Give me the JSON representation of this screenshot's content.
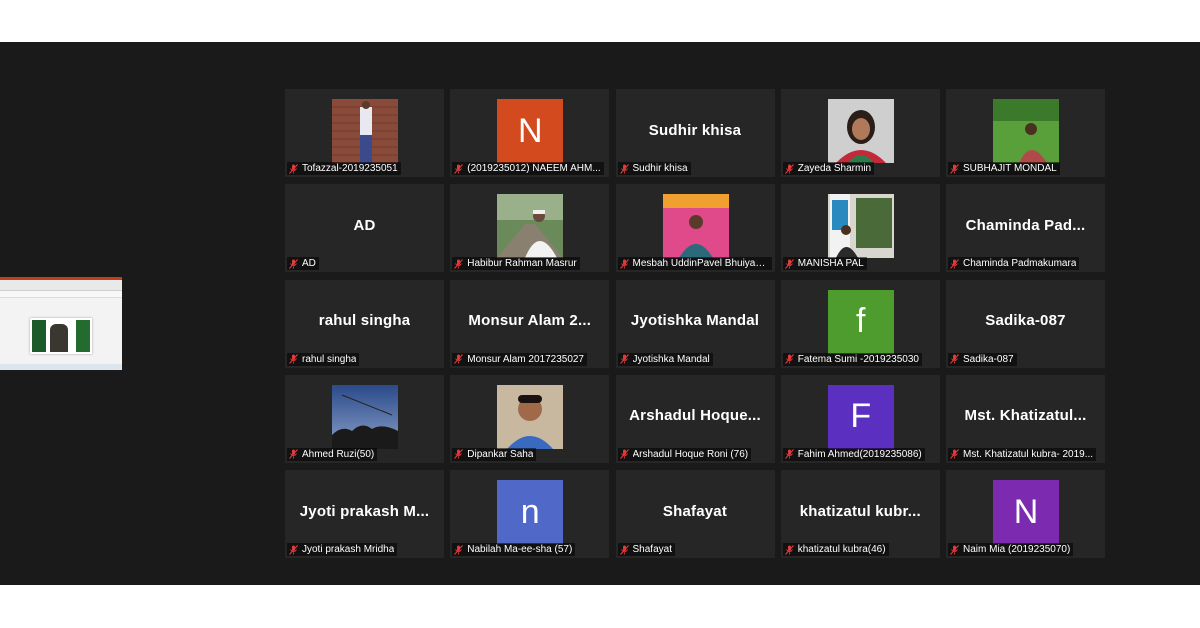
{
  "colors": {
    "background": "#1a1a1a",
    "tile": "#262626",
    "mic_muted": "#e03a3a"
  },
  "tiles": [
    {
      "label": "Tofazzal-2019235051",
      "type": "photo",
      "photo": "photo-brick-wall"
    },
    {
      "label": "(2019235012) NAEEM AHM...",
      "type": "avatar",
      "initial": "N",
      "color": "#d34a1f"
    },
    {
      "label": "Sudhir khisa",
      "type": "name",
      "display": "Sudhir khisa"
    },
    {
      "label": "Zayeda Sharmin",
      "type": "photo",
      "photo": "photo-woman"
    },
    {
      "label": "SUBHAJIT MONDAL",
      "type": "photo",
      "photo": "photo-green-field"
    },
    {
      "label": "AD",
      "type": "name",
      "display": "AD"
    },
    {
      "label": "Habibur Rahman Masrur",
      "type": "photo",
      "photo": "photo-park-path"
    },
    {
      "label": "Mesbah UddinPavel Bhuiyan...",
      "type": "photo",
      "photo": "photo-decorated-wall"
    },
    {
      "label": "MANISHA PAL",
      "type": "photo",
      "photo": "photo-banner-indoor"
    },
    {
      "label": "Chaminda Padmakumara",
      "type": "name",
      "display": "Chaminda Pad..."
    },
    {
      "label": "rahul singha",
      "type": "name",
      "display": "rahul singha"
    },
    {
      "label": "Monsur Alam 2017235027",
      "type": "name",
      "display": "Monsur Alam 2..."
    },
    {
      "label": "Jyotishka Mandal",
      "type": "name",
      "display": "Jyotishka Mandal"
    },
    {
      "label": "Fatema Sumi -2019235030",
      "type": "avatar",
      "initial": "f",
      "color": "#4e9c2d"
    },
    {
      "label": "Sadika-087",
      "type": "name",
      "display": "Sadika-087"
    },
    {
      "label": "Ahmed Ruzi(50)",
      "type": "photo",
      "photo": "photo-dusk-sky"
    },
    {
      "label": "Dipankar Saha",
      "type": "photo",
      "photo": "photo-man-smiling"
    },
    {
      "label": "Arshadul Hoque Roni (76)",
      "type": "name",
      "display": "Arshadul Hoque..."
    },
    {
      "label": "Fahim Ahmed(2019235086)",
      "type": "avatar",
      "initial": "F",
      "color": "#5b2fbf"
    },
    {
      "label": "Mst. Khatizatul kubra- 2019...",
      "type": "name",
      "display": "Mst. Khatizatul..."
    },
    {
      "label": "Jyoti prakash Mridha",
      "type": "name",
      "display": "Jyoti prakash M..."
    },
    {
      "label": "Nabilah Ma-ee-sha (57)",
      "type": "avatar",
      "initial": "n",
      "color": "#5069c9"
    },
    {
      "label": "Shafayat",
      "type": "name",
      "display": "Shafayat"
    },
    {
      "label": "khatizatul kubra(46)",
      "type": "name",
      "display": "khatizatul kubr..."
    },
    {
      "label": "Naim  Mia (2019235070)",
      "type": "avatar",
      "initial": "N",
      "color": "#7c2bb0"
    }
  ]
}
